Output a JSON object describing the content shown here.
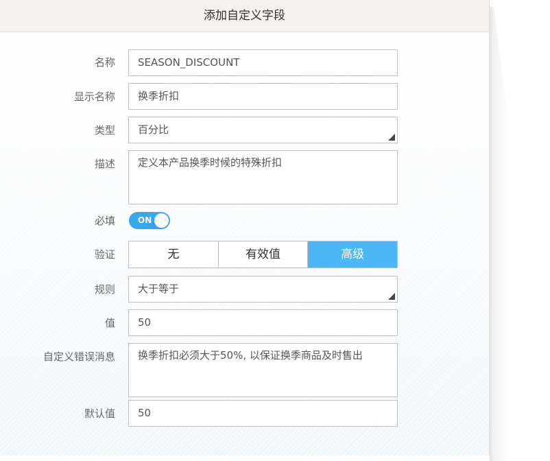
{
  "dialog": {
    "title": "添加自定义字段"
  },
  "form": {
    "name": {
      "label": "名称",
      "value": "SEASON_DISCOUNT"
    },
    "display_name": {
      "label": "显示名称",
      "value": "换季折扣"
    },
    "type": {
      "label": "类型",
      "value": "百分比"
    },
    "description": {
      "label": "描述",
      "value": "定义本产品换季时候的特殊折扣"
    },
    "required": {
      "label": "必填",
      "toggle_text": "ON"
    },
    "validation": {
      "label": "验证",
      "options": [
        "无",
        "有效值",
        "高级"
      ],
      "selected": "高级"
    },
    "rule": {
      "label": "规则",
      "value": "大于等于"
    },
    "value": {
      "label": "值",
      "value": "50"
    },
    "error_message": {
      "label": "自定义错误消息",
      "value": "换季折扣必须大于50%, 以保证换季商品及时售出"
    },
    "default_value": {
      "label": "默认值",
      "value": "50"
    }
  },
  "colors": {
    "accent": "#4bb8f5",
    "toggle_on": "#36a8f0",
    "header_bg": "#f5f1ef"
  }
}
